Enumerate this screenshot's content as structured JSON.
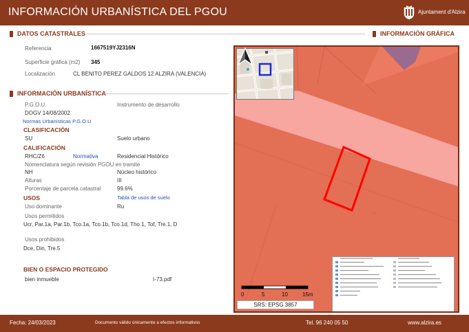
{
  "header": {
    "title": "INFORMACIÓN URBANÍSTICA DEL PGOU",
    "logo_text": "Ajuntament d'Alzira"
  },
  "catastrales": {
    "heading": "DATOS CATASTRALES",
    "referencia_label": "Referencia",
    "referencia_value": "1667519YJ2316N",
    "superficie_label": "Superficie gráfica (m2)",
    "superficie_value": "345",
    "localizacion_label": "Localización",
    "localizacion_value": "CL BENITO PEREZ GALDOS 12 ALZIRA (VALENCIA)"
  },
  "grafica": {
    "heading": "INFORMACIÓN GRÁFICA"
  },
  "urbanistica": {
    "heading": "INFORMACIÓN URBANÍSTICA",
    "pgou_label": "P.G.O.U.",
    "instrumento_label": "Instrumento de desarrollo",
    "dogv": "DOGV 14/08/2002",
    "normas_link": "Normas Urbanísticas P.G.O.U",
    "clasificacion_head": "CLASIFICACIÓN",
    "clas_code": "SU",
    "clas_value": "Suelo urbano",
    "calificacion_head": "CALIFICACIÓN",
    "calif_code": "RHC/Z6",
    "normativa_link": "Normativa",
    "calif_value": "Residencial Histórico",
    "nomenclatura": "Nomenclatura según revisión PGOU en tramite",
    "nh_code": "NH",
    "nh_value": "Núcleo histórico",
    "alturas_label": "Alturas",
    "alturas_value": "III",
    "porcentaje_label": "Porcentaje de parcela catastral",
    "porcentaje_value": "99.6%",
    "usos_head": "USOS",
    "tabla_link": "Tabla de usos de suelo",
    "uso_dom_label": "Uso dominante",
    "uso_dom_value": "Ru",
    "usos_perm_label": "Usos permitidos",
    "usos_perm_value": "Ucr, Par.1a, Par.1b, Tco.1a, Tco.1b, Tco.1d, Tho.1, Tof, Tre.1, D",
    "usos_proh_label": "Usos prohibidos",
    "usos_proh_value": "Dce, Din, Tre.5",
    "protegido_head": "BIEN O ESPACIO PROTEGIDO",
    "bien_label": "bien inmueble",
    "bien_file": "I-73.pdf"
  },
  "map": {
    "scale_ticks": [
      "0",
      "5",
      "10",
      "15m"
    ],
    "srs": "SRS: EPSG 3857",
    "icons": [
      "north-arrow-icon"
    ],
    "colors": {
      "zone": "#e36f55",
      "band": "#f7a6a0",
      "parcel_outline": "#ff0000",
      "equipment": "#9a6b8f"
    }
  },
  "footer": {
    "fecha": "Fecha: 24/03/2023",
    "aviso": "Documento válido únicamente a efectos informativos",
    "tel": "Tel. 96 240 05 50",
    "web": "www.alzira.es"
  }
}
